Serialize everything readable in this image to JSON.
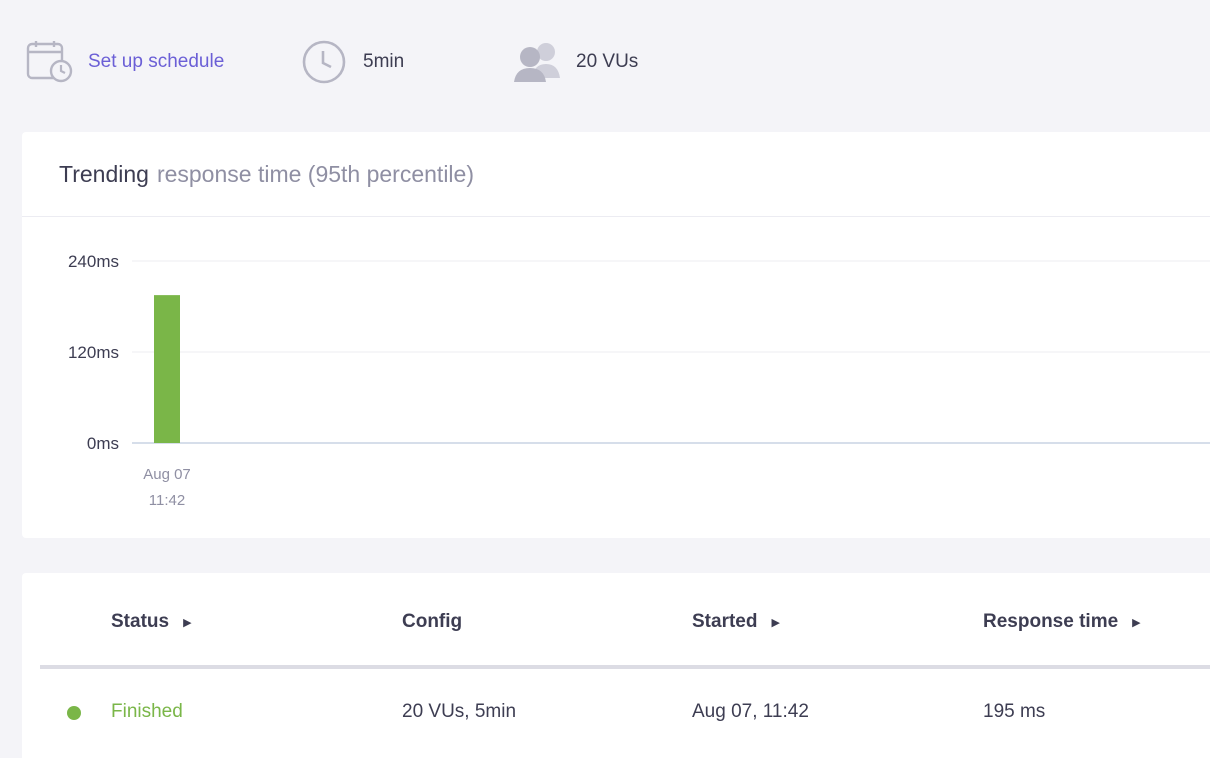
{
  "header": {
    "schedule_label": "Set up schedule",
    "duration": "5min",
    "vus": "20 VUs"
  },
  "chart": {
    "title_strong": "Trending",
    "title_rest": "response time (95th percentile)"
  },
  "chart_data": {
    "type": "bar",
    "title": "Trending response time (95th percentile)",
    "categories": [
      "Aug 07\n11:42"
    ],
    "values": [
      195
    ],
    "y_unit": "ms",
    "ylim": [
      0,
      240
    ],
    "y_ticks": [
      {
        "value": 0,
        "label": "0ms"
      },
      {
        "value": 120,
        "label": "120ms"
      },
      {
        "value": 240,
        "label": "240ms"
      }
    ],
    "x_tick_lines": [
      "Aug 07",
      "11:42"
    ],
    "bar_color": "#7ab648",
    "grid": true
  },
  "table": {
    "headers": {
      "status": "Status",
      "config": "Config",
      "started": "Started",
      "response_time": "Response time"
    },
    "rows": [
      {
        "status": "Finished",
        "config": "20 VUs, 5min",
        "started": "Aug 07, 11:42",
        "response_time": "195 ms"
      }
    ]
  },
  "colors": {
    "accent": "#6b5fd6",
    "success": "#7ab648",
    "icon_gray": "#b6b6c4"
  },
  "icons": {
    "schedule": "calendar-clock-icon",
    "duration": "clock-icon",
    "vus": "users-icon",
    "sort": "caret-right-icon"
  }
}
